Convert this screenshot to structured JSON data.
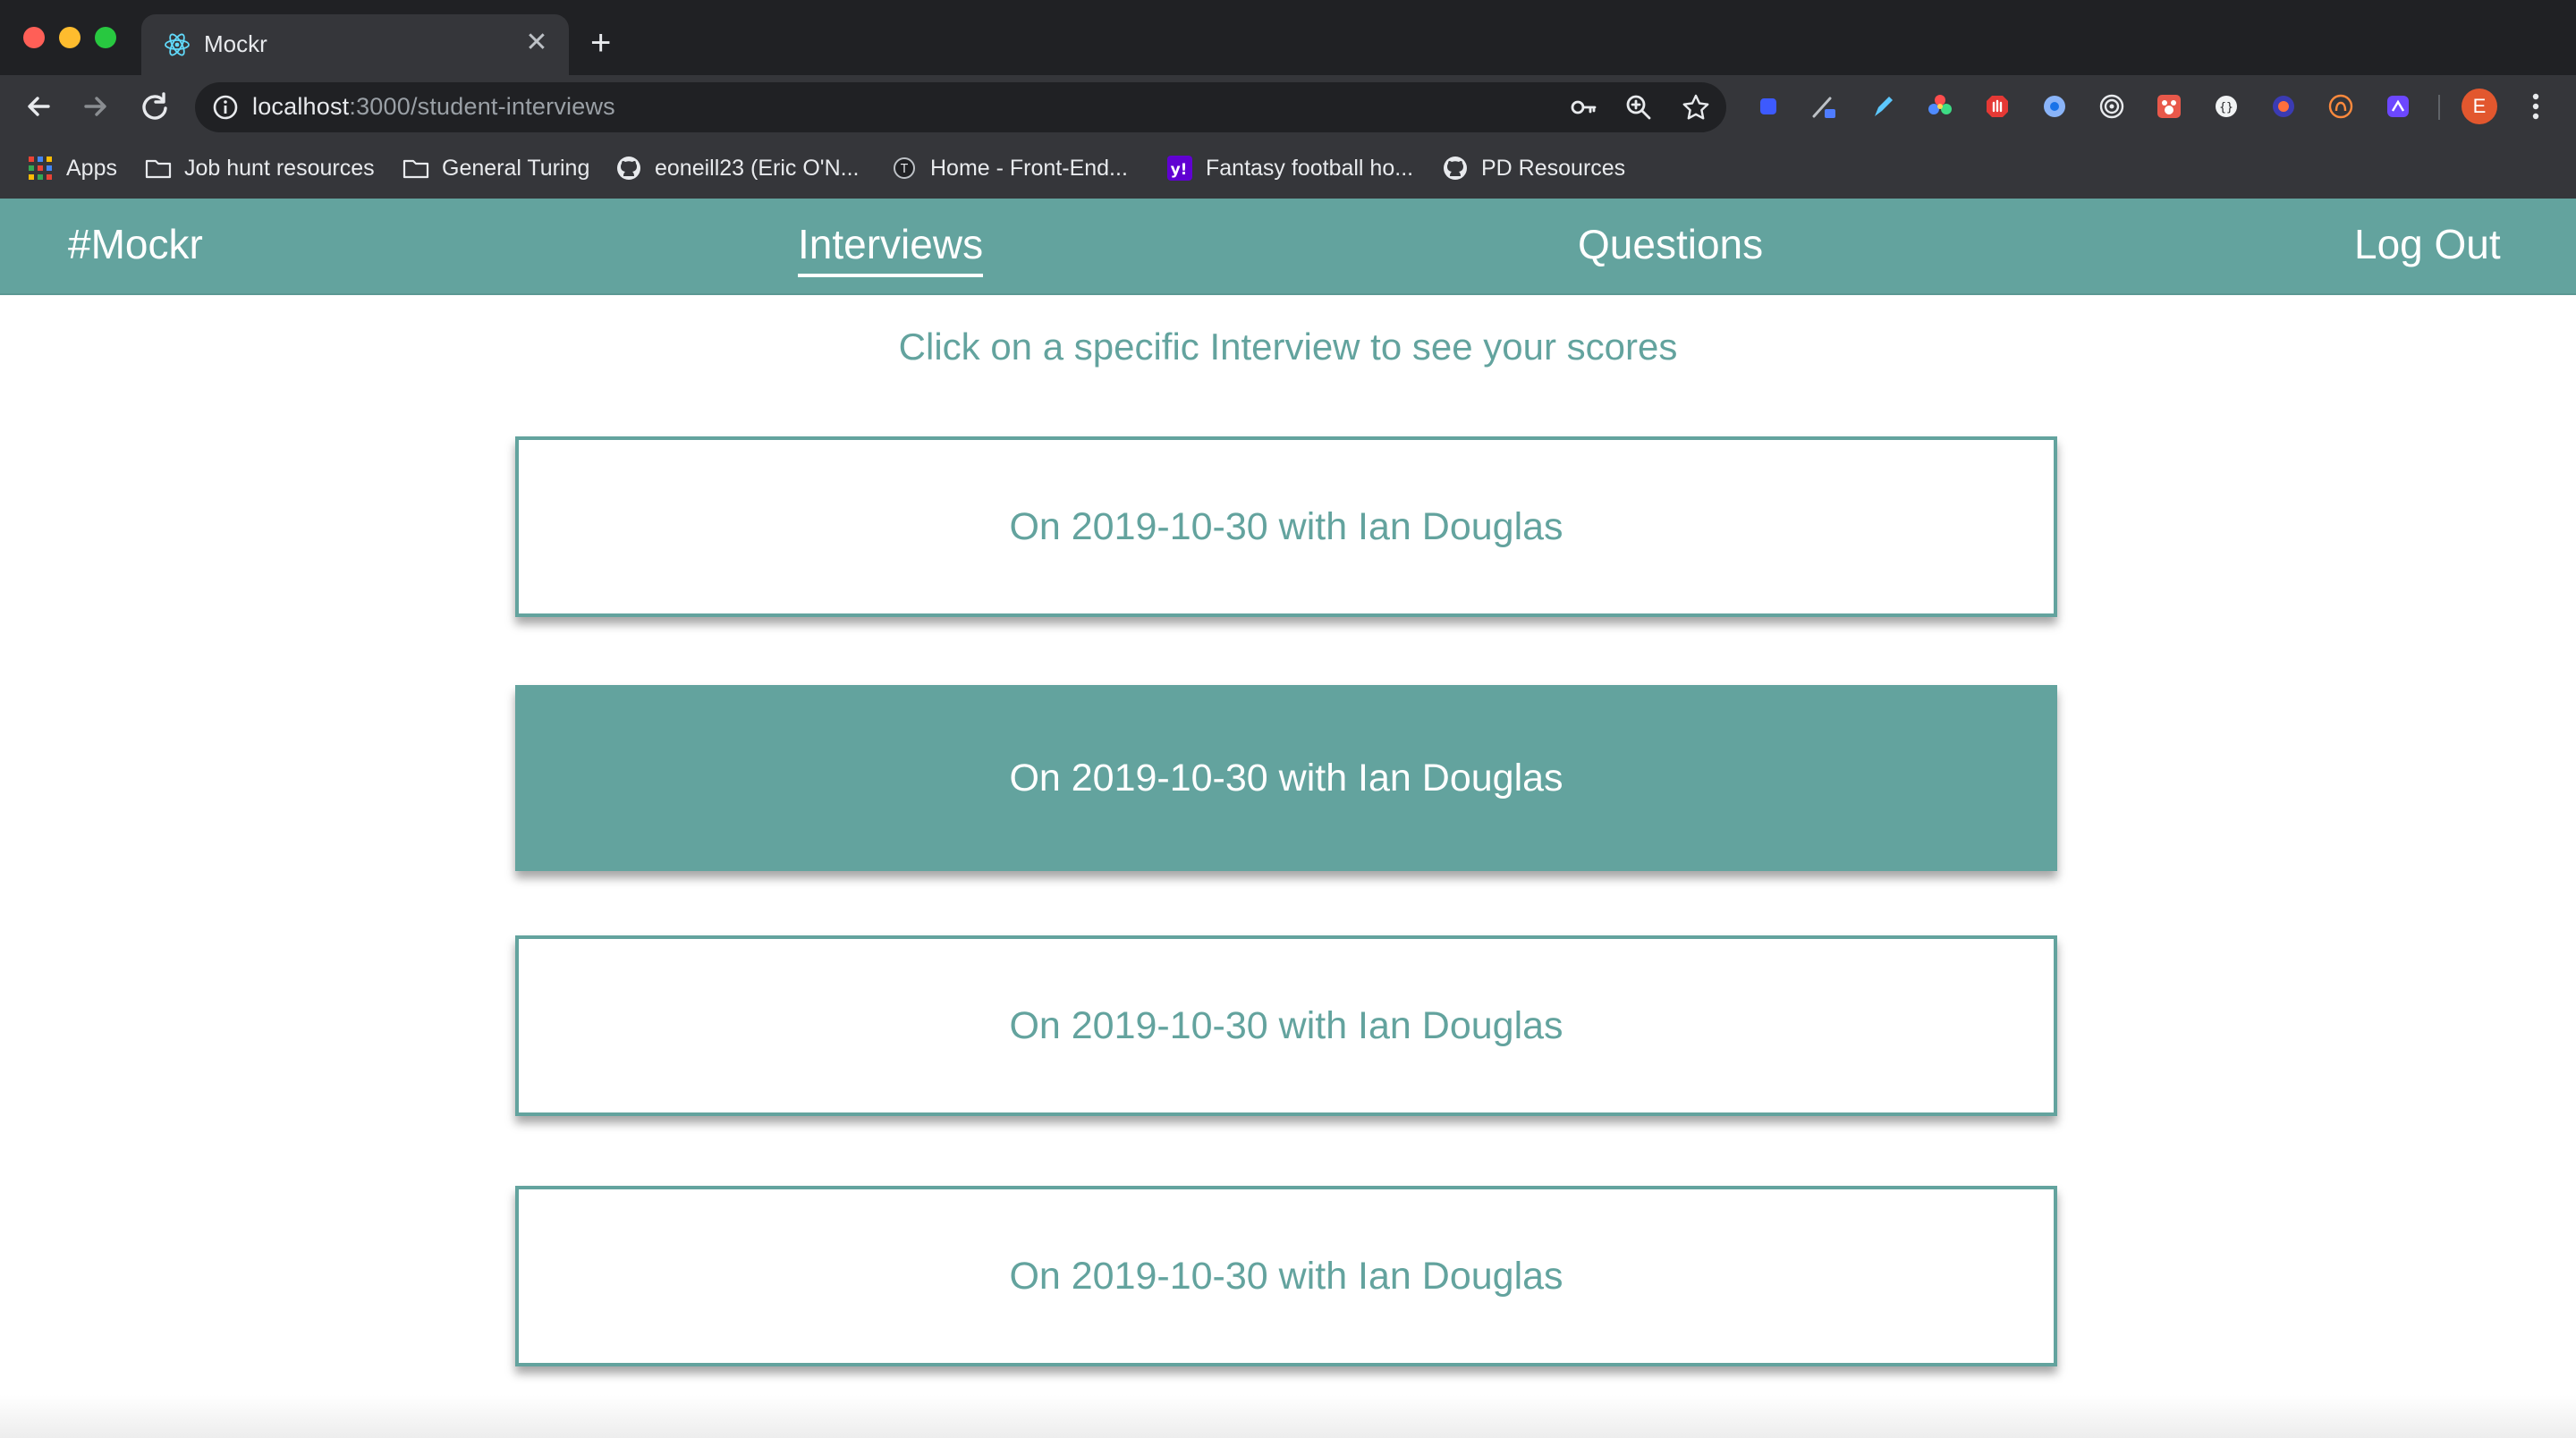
{
  "browser": {
    "tab": {
      "title": "Mockr"
    },
    "address": {
      "host": "localhost",
      "path": ":3000/student-interviews"
    },
    "profile_initial": "E",
    "bookmarks": [
      {
        "label": "Apps",
        "icon": "apps-grid-icon"
      },
      {
        "label": "Job hunt resources",
        "icon": "folder-icon"
      },
      {
        "label": "General Turing",
        "icon": "folder-icon"
      },
      {
        "label": "eoneill23 (Eric O'N...",
        "icon": "github-icon"
      },
      {
        "label": "Home - Front-End...",
        "icon": "turing-icon"
      },
      {
        "label": "Fantasy football ho...",
        "icon": "yahoo-icon"
      },
      {
        "label": "PD Resources",
        "icon": "github-icon"
      }
    ]
  },
  "app": {
    "brand": "#Mockr",
    "nav": {
      "interviews": "Interviews",
      "questions": "Questions",
      "logout": "Log Out"
    },
    "subtitle": "Click on a specific Interview to see your scores",
    "interviews": [
      {
        "label": "On 2019-10-30 with Ian Douglas",
        "highlighted": false
      },
      {
        "label": "On 2019-10-30 with Ian Douglas",
        "highlighted": true
      },
      {
        "label": "On 2019-10-30 with Ian Douglas",
        "highlighted": false
      },
      {
        "label": "On 2019-10-30 with Ian Douglas",
        "highlighted": false
      }
    ]
  },
  "colors": {
    "accent": "#63a39e",
    "chrome_dark": "#202124",
    "chrome_toolbar": "#35363a"
  }
}
